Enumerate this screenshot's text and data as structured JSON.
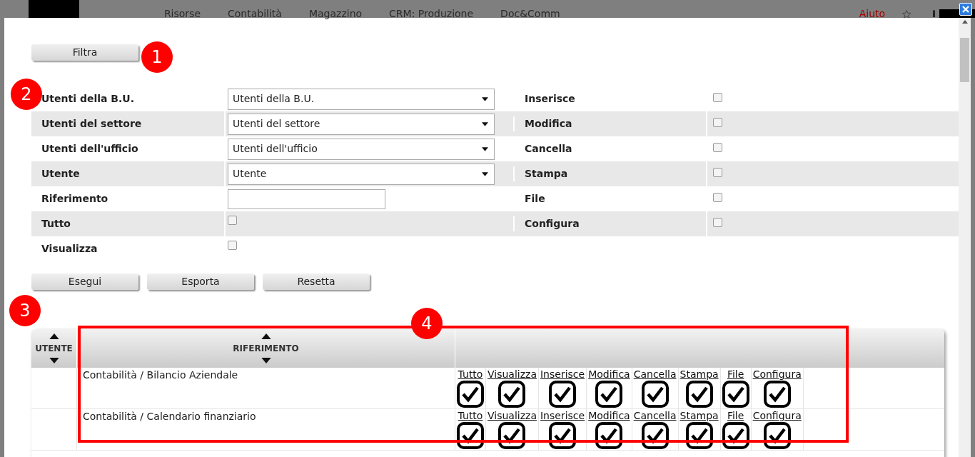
{
  "top_menu": {
    "items": [
      "Risorse",
      "Contabilità",
      "Magazzino",
      "CRM: Produzione",
      "Doc&Comm"
    ],
    "help": "Aiuto"
  },
  "filter_button": "Filtra",
  "markers": [
    "1",
    "2",
    "3",
    "4"
  ],
  "filters": [
    {
      "label": "Utenti della B.U.",
      "kind": "select",
      "value": "Utenti della B.U.",
      "right_label": "Inserisce",
      "right_checked": false
    },
    {
      "label": "Utenti del settore",
      "kind": "select",
      "value": "Utenti del settore",
      "right_label": "Modifica",
      "right_checked": false
    },
    {
      "label": "Utenti dell'ufficio",
      "kind": "select",
      "value": "Utenti dell'ufficio",
      "right_label": "Cancella",
      "right_checked": false
    },
    {
      "label": "Utente",
      "kind": "select",
      "value": "Utente",
      "right_label": "Stampa",
      "right_checked": false
    },
    {
      "label": "Riferimento",
      "kind": "text",
      "right_label": "File",
      "right_checked": false
    },
    {
      "label": "Tutto",
      "kind": "checkbox",
      "checked": false,
      "right_label": "Configura",
      "right_checked": false
    },
    {
      "label": "Visualizza",
      "kind": "checkbox",
      "checked": false
    }
  ],
  "actions": [
    "Esegui",
    "Esporta",
    "Resetta"
  ],
  "table": {
    "columns": [
      "UTENTE",
      "RIFERIMENTO"
    ],
    "rows": [
      {
        "reference": "Contabilità / Bilancio Aziendale",
        "permissions": [
          {
            "label": "Tutto",
            "checked": true
          },
          {
            "label": "Visualizza",
            "checked": true
          },
          {
            "label": "Inserisce",
            "checked": true
          },
          {
            "label": "Modifica",
            "checked": true
          },
          {
            "label": "Cancella",
            "checked": true
          },
          {
            "label": "Stampa",
            "checked": true
          },
          {
            "label": "File",
            "checked": true
          },
          {
            "label": "Configura",
            "checked": true
          }
        ]
      },
      {
        "reference": "Contabilità / Calendario finanziario",
        "permissions": [
          {
            "label": "Tutto",
            "checked": true
          },
          {
            "label": "Visualizza",
            "checked": true
          },
          {
            "label": "Inserisce",
            "checked": true
          },
          {
            "label": "Modifica",
            "checked": true
          },
          {
            "label": "Cancella",
            "checked": true
          },
          {
            "label": "Stampa",
            "checked": true
          },
          {
            "label": "File",
            "checked": true
          },
          {
            "label": "Configura",
            "checked": true
          }
        ]
      }
    ]
  }
}
